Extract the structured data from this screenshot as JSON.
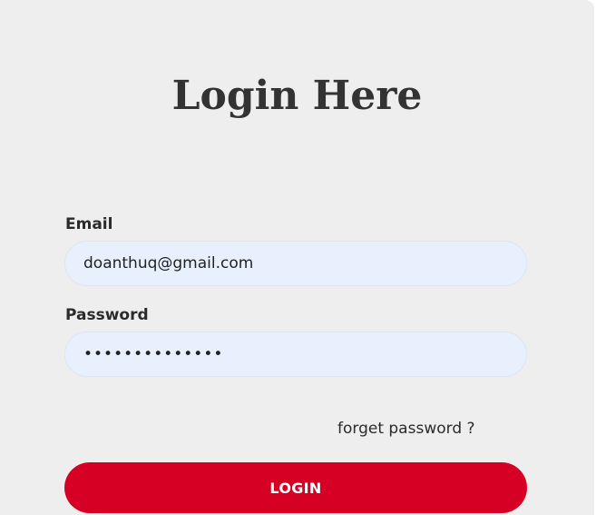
{
  "page": {
    "title": "Login Here"
  },
  "form": {
    "email_label": "Email",
    "email_value": "doanthuq@gmail.com",
    "password_label": "Password",
    "password_value": "••••••••••••••",
    "forgot_link": "forget password ?",
    "login_button": "LOGIN"
  },
  "colors": {
    "background": "#eeeeee",
    "input_background": "#e8f0fe",
    "button": "#d60024",
    "text": "#333333"
  }
}
